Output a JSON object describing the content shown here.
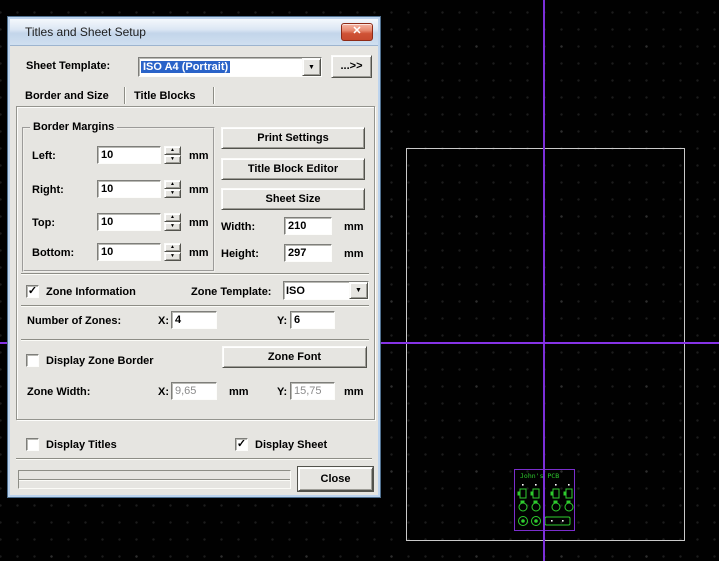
{
  "window": {
    "title": "Titles and Sheet Setup",
    "close_glyph": "✕"
  },
  "icons": {
    "check": "✓",
    "dropdown_arrow": "▼",
    "spinner_up": "▲",
    "spinner_down": "▼"
  },
  "units": {
    "mm": "mm"
  },
  "sheet_template": {
    "label": "Sheet Template:",
    "value": "ISO A4 (Portrait)",
    "more_button": "...>>"
  },
  "tabs": {
    "border_and_size": "Border and Size",
    "title_blocks": "Title Blocks",
    "active": "Border and Size"
  },
  "border_margins": {
    "title": "Border Margins",
    "rows": [
      {
        "label": "Left:",
        "value": "10"
      },
      {
        "label": "Right:",
        "value": "10"
      },
      {
        "label": "Top:",
        "value": "10"
      },
      {
        "label": "Bottom:",
        "value": "10"
      }
    ]
  },
  "actions": {
    "print_settings": "Print Settings",
    "title_block_editor": "Title Block Editor",
    "sheet_size": "Sheet Size",
    "zone_font": "Zone Font",
    "close": "Close"
  },
  "sheet_size": {
    "width_label": "Width:",
    "width": "210",
    "height_label": "Height:",
    "height": "297"
  },
  "zones": {
    "information_label": "Zone Information",
    "information_checked": true,
    "template_label": "Zone Template:",
    "template_value": "ISO",
    "number_label": "Number of Zones:",
    "x_label": "X:",
    "y_label": "Y:",
    "number_x": "4",
    "number_y": "6",
    "display_border_label": "Display Zone Border",
    "display_border_checked": false,
    "width_label": "Zone Width:",
    "width_x": "9,65",
    "width_y": "15,75"
  },
  "display_options": {
    "titles_label": "Display Titles",
    "titles_checked": false,
    "sheet_label": "Display Sheet",
    "sheet_checked": true
  },
  "canvas": {
    "pcb_label": "John's PCB",
    "colors": {
      "background": "#010101",
      "crosshair": "#7b2fd9",
      "sheet_outline": "#c9c9c9",
      "pcb_outline": "#7a2ecc",
      "pcb_green": "#2ecc2e"
    }
  }
}
